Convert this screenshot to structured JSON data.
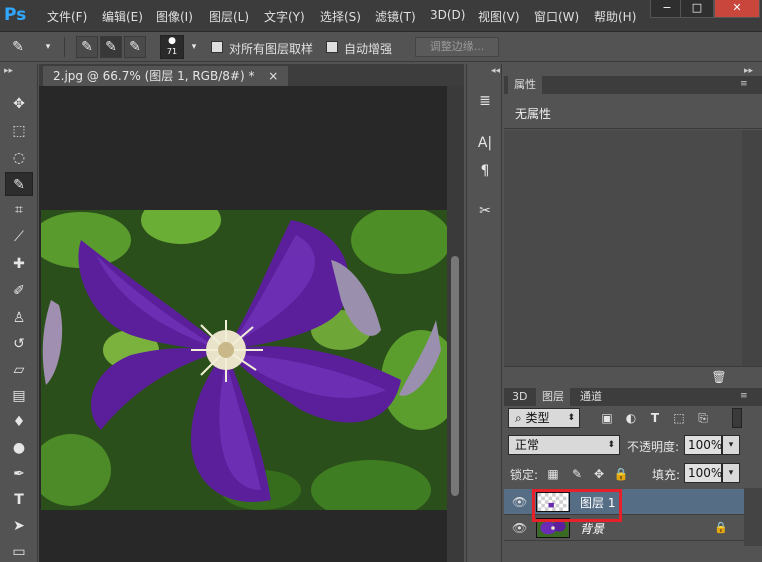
{
  "app": {
    "logo": "Ps"
  },
  "menu": [
    "文件(F)",
    "编辑(E)",
    "图像(I)",
    "图层(L)",
    "文字(Y)",
    "选择(S)",
    "滤镜(T)",
    "3D(D)",
    "视图(V)",
    "窗口(W)",
    "帮助(H)"
  ],
  "window_controls": {
    "minimize": "−",
    "maximize": "□",
    "close": "✕"
  },
  "options": {
    "brush_size": "71",
    "sample_all_layers_label": "对所有图层取样",
    "auto_enhance_label": "自动增强",
    "refine_edge_label": "调整边缘..."
  },
  "document": {
    "tab_title": "2.jpg @ 66.7% (图层 1, RGB/8#) *",
    "tab_close": "×"
  },
  "properties": {
    "tab": "属性",
    "empty_text": "无属性"
  },
  "layers_panel": {
    "tabs": [
      "3D",
      "图层",
      "通道"
    ],
    "filter_label": "类型",
    "blend_mode": "正常",
    "opacity_label": "不透明度:",
    "opacity_value": "100%",
    "lock_label": "锁定:",
    "fill_label": "填充:",
    "fill_value": "100%",
    "layers": [
      {
        "name": "图层 1",
        "selected": true
      },
      {
        "name": "背景",
        "selected": false,
        "locked": true
      }
    ]
  },
  "colors": {
    "accent": "#31a8ff",
    "highlight": "#e6212a",
    "selected_layer": "#566d86",
    "flower_purple": "#5b1f9c",
    "leaf_green": "#3b7b24"
  }
}
